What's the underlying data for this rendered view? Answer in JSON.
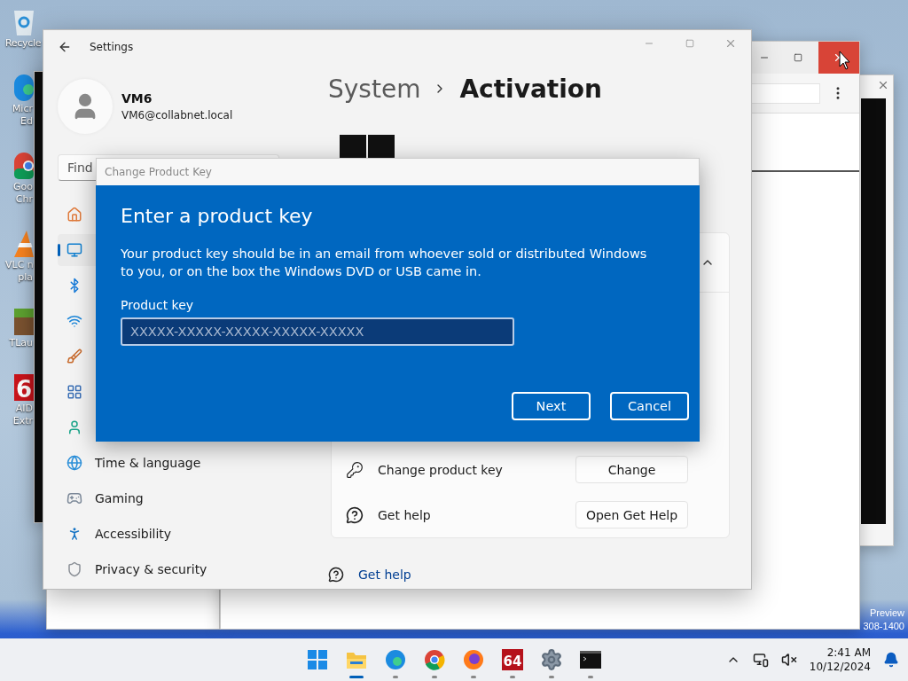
{
  "desktop": {
    "icons": [
      {
        "kind": "recycle",
        "lines": [
          "Recycle"
        ]
      },
      {
        "kind": "edge",
        "lines": [
          "Micr",
          "Ed"
        ]
      },
      {
        "kind": "chrome",
        "lines": [
          "Goo",
          "Chr"
        ]
      },
      {
        "kind": "vlc",
        "lines": [
          "VLC n",
          "pla"
        ]
      },
      {
        "kind": "grass",
        "lines": [
          "TLau"
        ]
      },
      {
        "kind": "aida",
        "badge": "6",
        "lines": [
          "AID",
          "Extr"
        ]
      }
    ],
    "watermark": [
      "Preview",
      "308-1400"
    ],
    "browser": {
      "close_hovered": true
    }
  },
  "settings": {
    "title": "Settings",
    "user": {
      "name": "VM6",
      "email": "VM6@collabnet.local"
    },
    "search": {
      "placeholder": "Find"
    },
    "nav": [
      {
        "kind": "home",
        "selected": false
      },
      {
        "kind": "system",
        "selected": true
      },
      {
        "kind": "bluetooth",
        "selected": false
      },
      {
        "kind": "network",
        "selected": false
      },
      {
        "kind": "personalization",
        "selected": false
      },
      {
        "kind": "apps",
        "selected": false
      },
      {
        "kind": "accounts",
        "selected": false
      },
      {
        "kind": "time",
        "label": "Time & language",
        "selected": false
      },
      {
        "kind": "gaming",
        "label": "Gaming",
        "selected": false
      },
      {
        "kind": "accessibility",
        "label": "Accessibility",
        "selected": false
      },
      {
        "kind": "privacy",
        "label": "Privacy & security",
        "selected": false
      }
    ],
    "breadcrumb": {
      "parent": "System",
      "current": "Activation"
    },
    "card": {
      "expanded": true,
      "rows": [
        {
          "kind": "key",
          "label": "Change product key",
          "button": "Change"
        },
        {
          "kind": "help",
          "label": "Get help",
          "button": "Open Get Help"
        }
      ]
    },
    "help_link": "Get help"
  },
  "dialog": {
    "title": "Change Product Key",
    "heading": "Enter a product key",
    "body": "Your product key should be in an email from whoever sold or distributed Windows to you, or on the box the Windows DVD or USB came in.",
    "field_label": "Product key",
    "placeholder": "XXXXX-XXXXX-XXXXX-XXXXX-XXXXX",
    "buttons": [
      "Next",
      "Cancel"
    ]
  },
  "taskbar": {
    "apps": [
      {
        "kind": "start",
        "running": false,
        "active": false
      },
      {
        "kind": "explorer",
        "running": true,
        "active": true
      },
      {
        "kind": "edge",
        "running": true,
        "active": false
      },
      {
        "kind": "chrome",
        "running": true,
        "active": false
      },
      {
        "kind": "firefox",
        "running": true,
        "active": false
      },
      {
        "kind": "aida",
        "badge": "64",
        "running": true,
        "active": false
      },
      {
        "kind": "settings",
        "running": true,
        "active": false
      },
      {
        "kind": "terminal",
        "running": true,
        "active": false
      }
    ],
    "clock": {
      "time": "2:41 AM",
      "date": "10/12/2024"
    }
  }
}
